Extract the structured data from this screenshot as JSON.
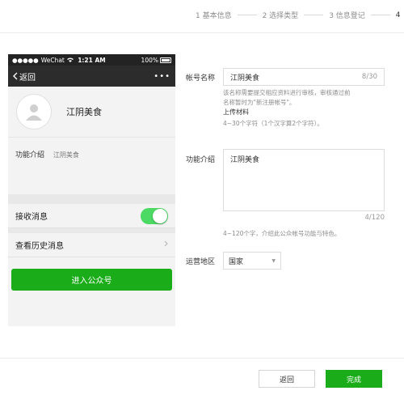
{
  "steps": [
    {
      "label": "1 基本信息"
    },
    {
      "label": "2 选择类型"
    },
    {
      "label": "3 信息登记"
    },
    {
      "label": "4"
    }
  ],
  "phone": {
    "carrier": "WeChat",
    "time": "1:21 AM",
    "battery": "100%",
    "back_label": "返回",
    "more": "•••",
    "account_name": "江阴美食",
    "func_label": "功能介绍",
    "func_value": "江阴美食",
    "receive_label": "接收消息",
    "receive_on": true,
    "history_label": "查看历史消息",
    "enter_button": "进入公众号"
  },
  "form": {
    "name_label": "帐号名称",
    "name_value": "江阴美食",
    "name_count": "8/30",
    "name_hint_1": "该名称需要提交相应资料进行审核，审核通过前",
    "name_hint_2": "名称暂时为\"新注册帐号\"。",
    "upload_link": "上传材料",
    "name_rule": "4~30个字符（1个汉字算2个字符）。",
    "intro_label": "功能介绍",
    "intro_value": "江阴美食",
    "intro_count": "4/120",
    "intro_rule": "4~120个字，介绍此公众帐号功能与特色。",
    "region_label": "运营地区",
    "region_value": "国家"
  },
  "footer": {
    "back_button": "返回",
    "done_button": "完成"
  },
  "colors": {
    "accent_green": "#1aad19",
    "toggle_green": "#4cd964"
  }
}
